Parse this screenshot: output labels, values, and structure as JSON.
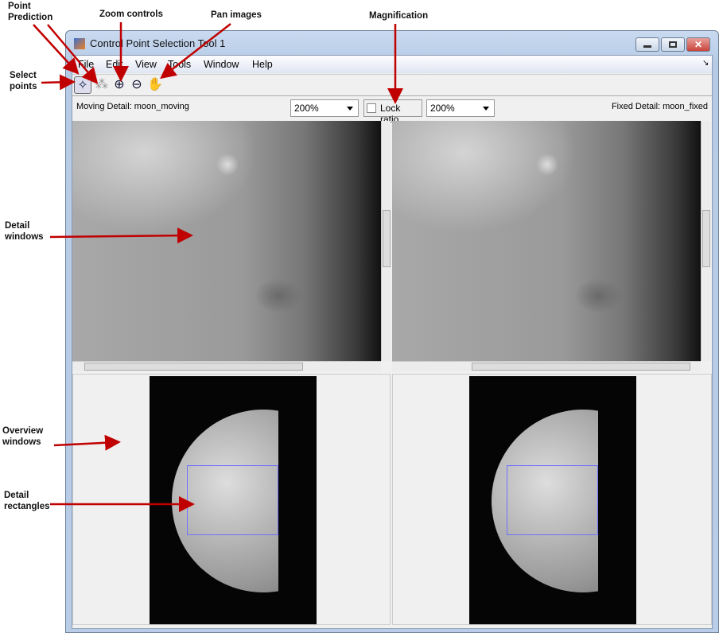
{
  "annotations": {
    "point_prediction": "Point\nPrediction",
    "zoom_controls": "Zoom controls",
    "pan_images": "Pan images",
    "magnification": "Magnification",
    "select_points": "Select\npoints",
    "detail_windows": "Detail\nwindows",
    "overview_windows": "Overview\nwindows",
    "detail_rectangles": "Detail\nrectangles"
  },
  "window": {
    "title": "Control Point Selection Tool 1"
  },
  "menu": [
    "File",
    "Edit",
    "View",
    "Tools",
    "Window",
    "Help"
  ],
  "toolbar": {
    "icons": [
      "select-points-icon",
      "point-prediction-icon",
      "zoom-in-icon",
      "zoom-out-icon",
      "pan-hand-icon"
    ]
  },
  "detail": {
    "moving_label": "Moving Detail: moon_moving",
    "fixed_label": "Fixed Detail: moon_fixed",
    "moving_zoom": "200%",
    "fixed_zoom": "200%",
    "lock_ratio": "Lock ratio",
    "lock_checked": false
  },
  "colors": {
    "arrow": "#c00000",
    "rect": "#7070ff"
  }
}
